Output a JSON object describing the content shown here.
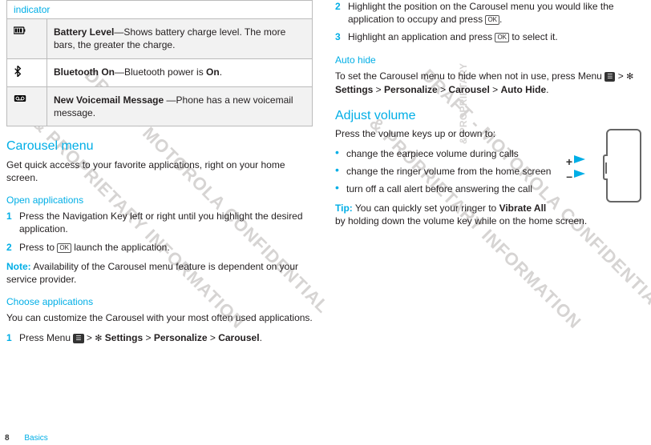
{
  "table": {
    "header": "indicator",
    "rows": [
      {
        "icon": "battery-icon",
        "desc_bold": "Battery Level",
        "desc_rest": "—Shows battery charge level. The more bars, the greater the charge."
      },
      {
        "icon": "bluetooth-icon",
        "desc_bold": "Bluetooth On",
        "desc_rest": "—Bluetooth power is ",
        "desc_trail_bold": "On",
        "desc_trail_rest": "."
      },
      {
        "icon": "voicemail-icon",
        "desc_bold": "New Voicemail Message ",
        "desc_rest": "—Phone has a new voicemail message."
      }
    ]
  },
  "left": {
    "h_carousel": "Carousel menu",
    "p_carousel": "Get quick access to your favorite applications, right on your home screen.",
    "h_open": "Open applications",
    "open_steps": [
      "Press the Navigation Key left or right until you highlight the desired application.",
      {
        "pre": "Press to ",
        "key": "OK",
        "post": " launch the application."
      }
    ],
    "note_label": "Note:",
    "note_text": " Availability of the Carousel menu feature is dependent on your service provider.",
    "h_choose": "Choose applications",
    "p_choose": "You can customize the Carousel with your most often used applications.",
    "choose_steps": [
      {
        "pre": "Press Menu ",
        "menu_key": "☰",
        "mid1": " > ",
        "gear": "✻",
        "settings": "Settings",
        "mid2": " > ",
        "pers": "Personalize",
        "mid3": " > ",
        "car": "Carousel",
        "end": "."
      }
    ]
  },
  "right": {
    "choose_steps_cont": [
      {
        "num": "2",
        "pre": "Highlight the position on the Carousel menu you would like the application to occupy and press ",
        "key": "OK",
        "post": "."
      },
      {
        "num": "3",
        "pre": "Highlight an application and press ",
        "key": "OK",
        "post": " to select it."
      }
    ],
    "h_autohide": "Auto hide",
    "autohide": {
      "pre": "To set the Carousel menu to hide when not in use, press Menu ",
      "menu_key": "☰",
      "mid1": " > ",
      "settings": "Settings",
      "mid2": " > ",
      "pers": "Personalize",
      "mid3": " > ",
      "car": "Carousel",
      "mid4": " > ",
      "ah": "Auto Hide",
      "end": "."
    },
    "h_volume": "Adjust volume",
    "p_volume": "Press the volume keys up or down to:",
    "vol_bullets": [
      "change the earpiece volume during calls",
      "change the ringer volume from the home screen",
      "turn off a call alert before answering the call"
    ],
    "tip_label": "Tip:",
    "tip_pre": " You can quickly set your ringer to ",
    "tip_bold": "Vibrate All",
    "tip_post": " by holding down the volume key while on the home screen.",
    "ill_plus": "+",
    "ill_minus": "–"
  },
  "footer": {
    "page": "8",
    "section": "Basics"
  },
  "watermarks": {
    "l1": "DRAFT - MOTOROLA CONFIDENTIAL",
    "l2": "& PROPRIETARY INFORMATION",
    "side": "& PROPRIETARY"
  }
}
